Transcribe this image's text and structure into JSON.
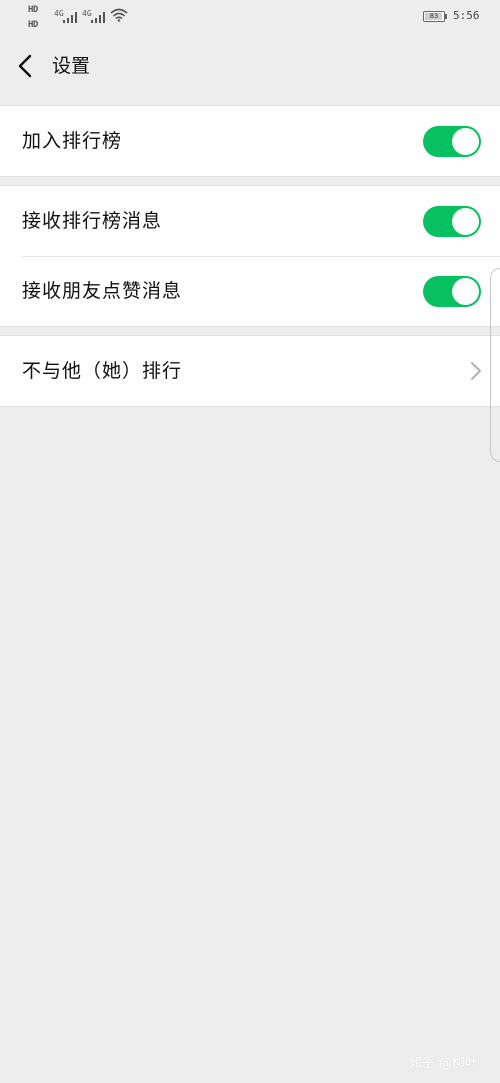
{
  "status_bar": {
    "hd_label_1": "HD",
    "hd_label_2": "HD",
    "network_1": "4G",
    "network_2": "4G",
    "battery_level": "83",
    "time": "5:56",
    "icons": [
      "signal-icon",
      "wifi-icon",
      "battery-icon"
    ]
  },
  "nav": {
    "back_icon": "back-arrow-icon",
    "title": "设置"
  },
  "sections": [
    {
      "rows": [
        {
          "label": "加入排行榜",
          "control": "toggle",
          "on": true
        }
      ]
    },
    {
      "rows": [
        {
          "label": "接收排行榜消息",
          "control": "toggle",
          "on": true
        },
        {
          "label": "接收朋友点赞消息",
          "control": "toggle",
          "on": true
        }
      ]
    },
    {
      "rows": [
        {
          "label": "不与他（她）排行",
          "control": "chevron",
          "icon": "chevron-right-icon"
        }
      ]
    }
  ],
  "watermark": "知乎 @柳叶",
  "colors": {
    "background": "#ededed",
    "card": "#ffffff",
    "toggle_on": "#07c160",
    "text": "#111111"
  }
}
